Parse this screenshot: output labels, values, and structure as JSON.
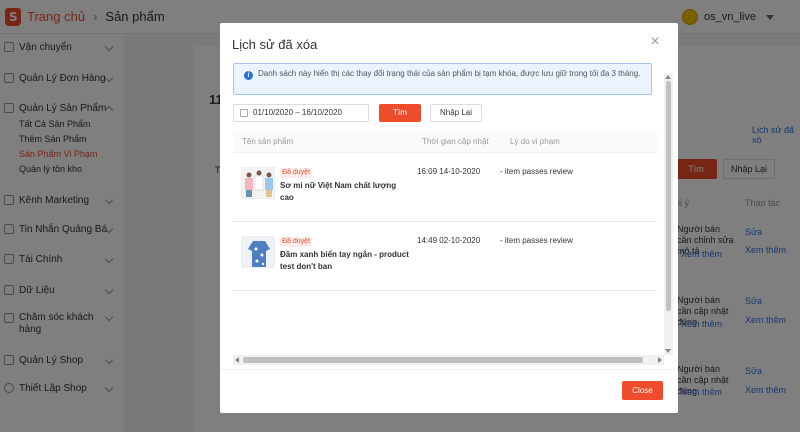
{
  "topbar": {
    "home": "Trang chủ",
    "separator": "›",
    "current": "Sản phẩm",
    "username": "os_vn_live"
  },
  "sidebar": {
    "shipping": "Vận chuyển",
    "orders": "Quản Lý Đơn Hàng",
    "products": "Quản Lý Sản Phẩm",
    "products_items": [
      "Tất Cả Sản Phẩm",
      "Thêm Sản Phẩm",
      "Sản Phẩm Vi Phạm",
      "Quản lý tồn kho"
    ],
    "marketing": "Kênh Marketing",
    "ads": "Tin Nhắn Quảng Bá",
    "finance": "Tài Chính",
    "data": "Dữ Liệu",
    "customer_care": "Chăm sóc khách hàng",
    "shop_mgmt": "Quản Lý Shop",
    "shop_setup": "Thiết Lập Shop"
  },
  "background": {
    "count_fragment": "11",
    "history_link": "Lịch sử đã xó",
    "find": "Tìm",
    "reset": "Nhập Lại",
    "col_note": "ôi ý",
    "col_action": "Thao tác",
    "t_fragment": "T",
    "rows": [
      {
        "note": "Người bán cần chỉnh sửa mô tả",
        "see_more": "Xem thêm",
        "edit": "Sửa",
        "more": "Xem thêm"
      },
      {
        "note": "Người bán cần cập nhật đúng",
        "see_more": "Xem thêm",
        "edit": "Sửa",
        "more": "Xem thêm"
      },
      {
        "note": "Người bán cần cập nhật đúng",
        "see_more": "Xem thêm",
        "edit": "Sửa",
        "more": "Xem thêm"
      }
    ]
  },
  "modal": {
    "title": "Lịch sử đã xóa",
    "notice": "Danh sách này hiển thị các thay đổi trạng thái của sản phẩm bị tạm khóa, được lưu giữ trong tối đa 3 tháng.",
    "date_range": "01/10/2020 – 16/10/2020",
    "find_button": "Tìm",
    "reset_button": "Nhập Lại",
    "columns": {
      "product": "Tên sản phẩm",
      "updated": "Thời gian cập nhật",
      "reason": "Lý do vi phạm"
    },
    "rows": [
      {
        "status": "Đã duyệt",
        "name": "Sơ mi nữ Việt Nam chất lượng cao",
        "time": "16:09 14-10-2020",
        "reason": "- item passes review"
      },
      {
        "status": "Đã duyệt",
        "name": "Đầm xanh biển tay ngắn - product test don't ban",
        "time": "14:49 02-10-2020",
        "reason": "- item passes review"
      }
    ],
    "close_button": "Close"
  },
  "colors": {
    "brand": "#ee4d2d",
    "info": "#2673dd",
    "link": "#2673dd"
  },
  "icons": [
    "shopee-logo-icon",
    "chevron-right-icon",
    "calendar-icon",
    "info-icon",
    "close-icon",
    "chevron-down-icon"
  ]
}
